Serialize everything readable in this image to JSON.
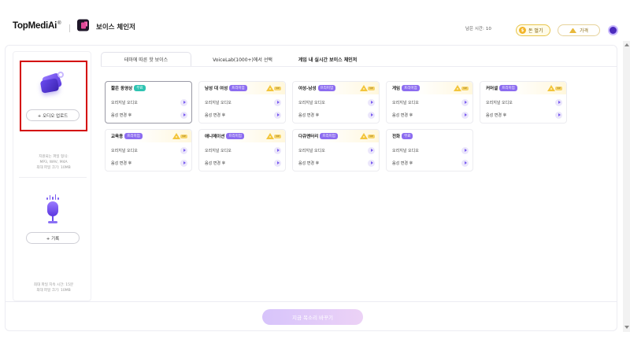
{
  "header": {
    "logo_text": "TopMediAi",
    "logo_mark": "®",
    "app_title": "보이스 체인저",
    "remaining_label": "남은 시간:",
    "remaining_value": "10",
    "earn_label": "돈 벌기",
    "price_label": "가격"
  },
  "sidebar": {
    "upload_button": "+ 오디오 업로드",
    "formats_line1": "지원되는 파일 형식:",
    "formats_line2": "MP3, WAV, M4A",
    "formats_line3": "최대 파일 크기: 10MB",
    "record_button": "+ 기록",
    "record_note_line1": "최대 파일 지속 시간: 15분",
    "record_note_line2": "최대 파일 크기: 10MB"
  },
  "tabs": [
    {
      "label": "테마에 따른 핫 보이스",
      "active": true
    },
    {
      "label": "VoiceLab(1000+)에서 선택",
      "active": false
    },
    {
      "label": "게임 내 실시간 보이스 체인저",
      "active": false
    }
  ],
  "cards": [
    {
      "title": "짧은 동영상",
      "tag": "무료",
      "tag_type": "free",
      "premium": false
    },
    {
      "title": "남성 대 여성",
      "tag": "프리미엄",
      "tag_type": "prem",
      "premium": true
    },
    {
      "title": "여성-남성",
      "tag": "프리미엄",
      "tag_type": "prem",
      "premium": true
    },
    {
      "title": "게임",
      "tag": "프리미엄",
      "tag_type": "prem",
      "premium": true
    },
    {
      "title": "커머셜",
      "tag": "프리미엄",
      "tag_type": "prem",
      "premium": true
    },
    {
      "title": "교육용",
      "tag": "프리미엄",
      "tag_type": "prem",
      "premium": true
    },
    {
      "title": "애니메이션",
      "tag": "프리미엄",
      "tag_type": "prem",
      "premium": true
    },
    {
      "title": "다큐멘터리",
      "tag": "프리미엄",
      "tag_type": "prem",
      "premium": true
    },
    {
      "title": "전화",
      "tag": "무료",
      "tag_type": "prem",
      "premium": false
    }
  ],
  "card_rows": {
    "original": "오리지널 오디오",
    "changed": "음성 변경 후"
  },
  "premium_badge": "VIP",
  "footer": {
    "change_button": "지금 목소리 바꾸기"
  },
  "colors": {
    "accent": "#7a5cf0",
    "free_tag": "#2fc4b2",
    "premium_tag": "#8c6cf0",
    "highlight": "#d40000"
  }
}
